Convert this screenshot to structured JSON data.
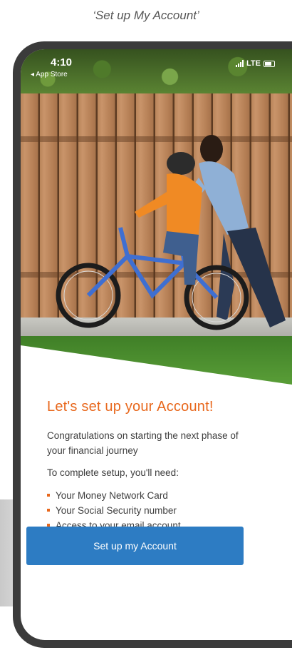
{
  "caption": "‘Set up My Account’",
  "status_bar": {
    "time": "4:10",
    "back_app": "◂ App Store",
    "network": "LTE"
  },
  "content": {
    "headline": "Let's set up your Account!",
    "intro": "Congratulations on starting the next phase of your financial journey",
    "need_label": "To complete setup, you'll need:",
    "requirements": [
      "Your Money Network Card",
      "Your Social Security number",
      "Access to your email account"
    ]
  },
  "cta": {
    "label": "Set up my Account"
  },
  "colors": {
    "accent_orange": "#e8681d",
    "button_blue": "#2d7cc3",
    "text_gray": "#3d3d3d"
  }
}
